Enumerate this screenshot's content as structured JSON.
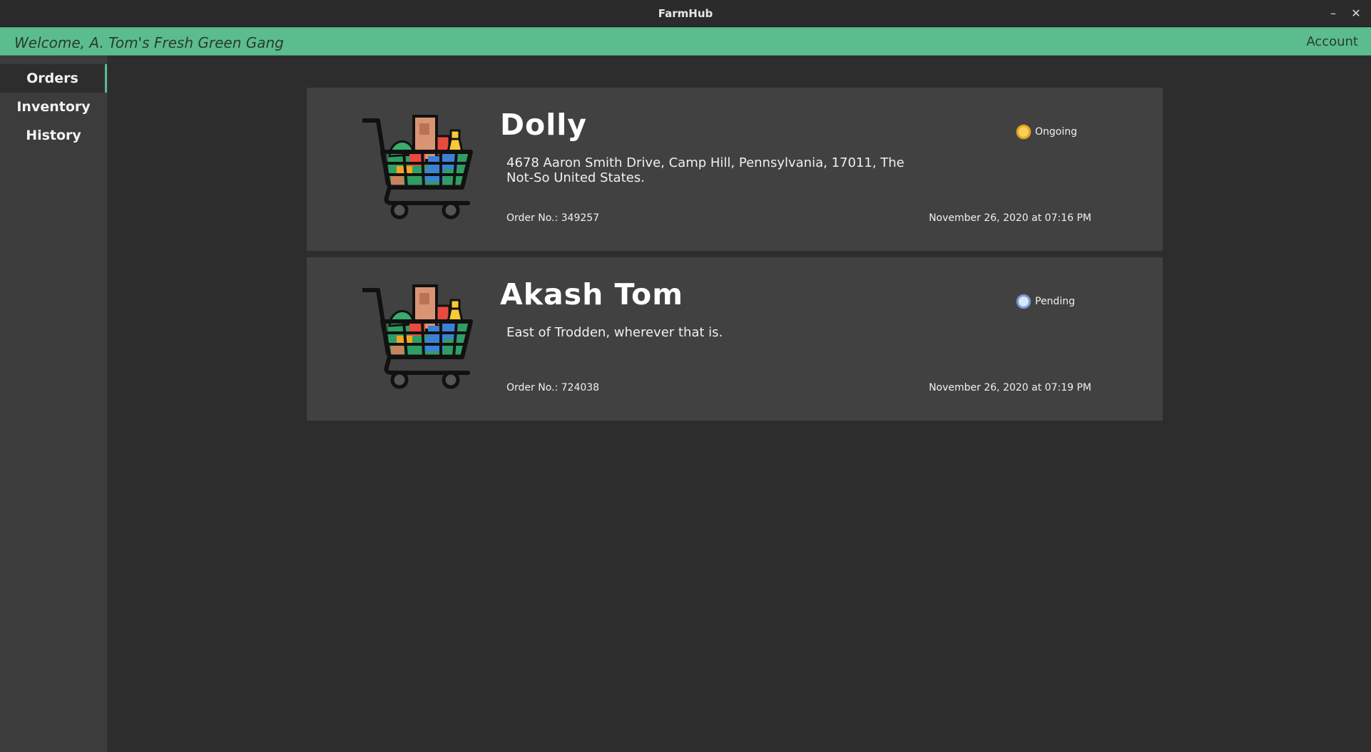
{
  "window": {
    "title": "FarmHub",
    "minimize": "–",
    "close": "✕"
  },
  "header": {
    "welcome": "Welcome, A. Tom's Fresh Green Gang",
    "account": "Account"
  },
  "sidebar": {
    "items": [
      {
        "label": "Orders"
      },
      {
        "label": "Inventory"
      },
      {
        "label": "History"
      }
    ],
    "active": "Orders"
  },
  "colors": {
    "accent": "#5bbd8d",
    "ongoing": "#f8cf5a",
    "pending": "#d7e8fb"
  },
  "orders": [
    {
      "customer": "Dolly",
      "address": "4678  Aaron Smith Drive, Camp Hill, Pennsylvania, 17011, The Not-So United States.",
      "status": "Ongoing",
      "order_no": "Order No.: 349257",
      "date": "November 26, 2020 at 07:16 PM",
      "icon": "shopping-cart-icon"
    },
    {
      "customer": "Akash Tom",
      "address": "East of Trodden, wherever that is.",
      "status": "Pending",
      "order_no": "Order No.: 724038",
      "date": "November 26, 2020 at 07:19 PM",
      "icon": "shopping-cart-icon"
    }
  ]
}
